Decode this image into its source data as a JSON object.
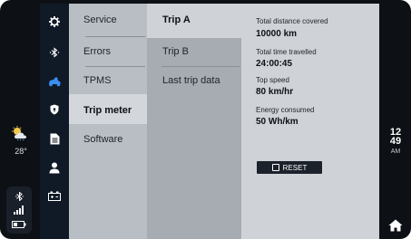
{
  "weather": {
    "icon": "partly-cloudy-icon",
    "temperature": "28°"
  },
  "rail": {
    "items": [
      {
        "icon": "gear-icon"
      },
      {
        "icon": "bluetooth-icon"
      },
      {
        "icon": "vehicle-icon",
        "accent": "#3a8ef0"
      },
      {
        "icon": "shield-icon"
      },
      {
        "icon": "document-icon"
      },
      {
        "icon": "user-icon"
      },
      {
        "icon": "battery-plus-icon"
      }
    ]
  },
  "menu": {
    "items": [
      "Service",
      "Errors",
      "TPMS",
      "Trip meter",
      "Software"
    ],
    "selected": "Trip meter"
  },
  "submenu": {
    "items": [
      "Trip A",
      "Trip B",
      "Last trip data"
    ],
    "selected": "Trip A"
  },
  "stats": {
    "distance_label": "Total distance covered",
    "distance_value": "10000 km",
    "time_label": "Total time travelled",
    "time_value": "24:00:45",
    "speed_label": "Top speed",
    "speed_value": "80 km/hr",
    "energy_label": "Energy consumed",
    "energy_value": "50 Wh/km"
  },
  "reset_label": "RESET",
  "clock": {
    "hour": "12",
    "minute": "49",
    "ampm": "AM"
  },
  "status": {
    "icons": [
      "bluetooth-icon",
      "signal-icon",
      "battery-icon"
    ]
  },
  "colors": {
    "bezel": "#0d1116",
    "accent": "#3a8ef0",
    "panel": "#cfd3d7"
  }
}
